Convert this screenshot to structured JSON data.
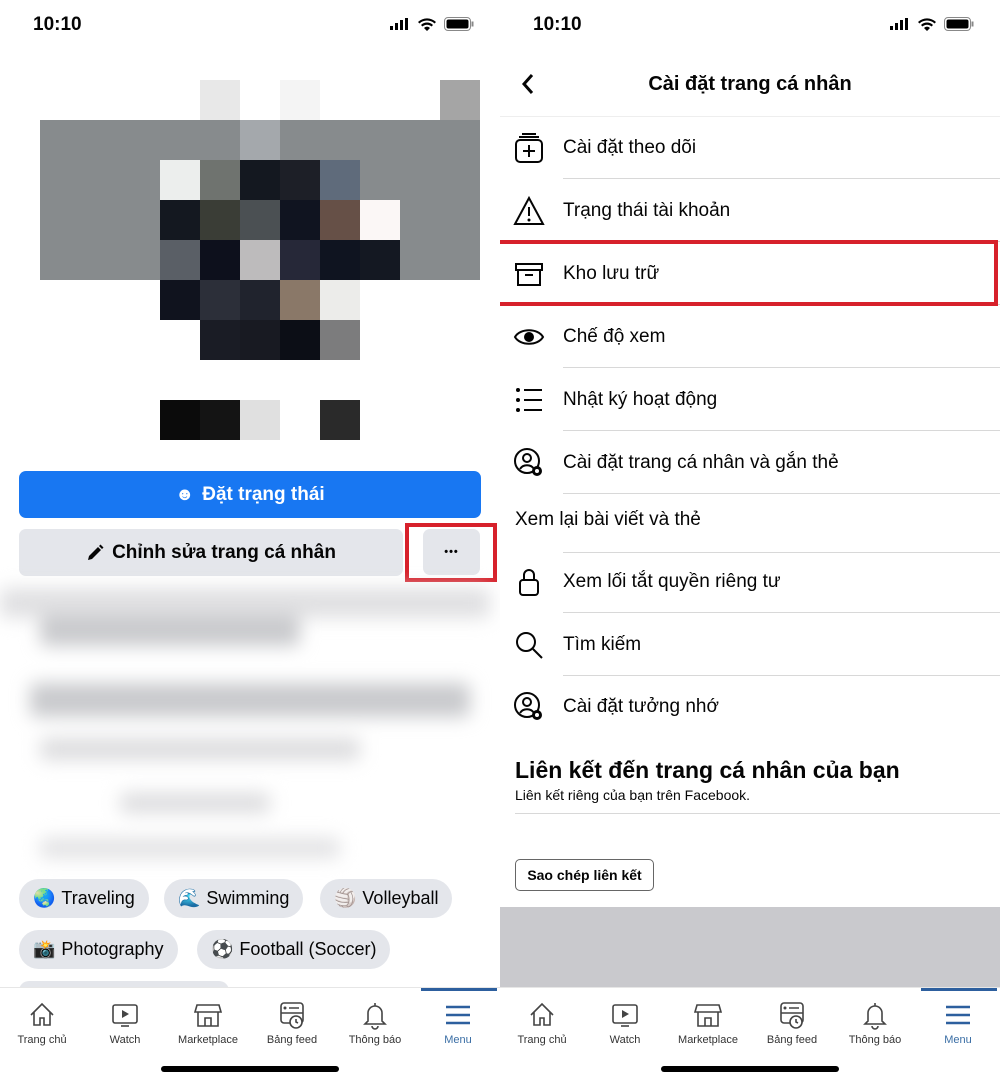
{
  "status": {
    "time": "10:10"
  },
  "left": {
    "set_status_label": "Đặt trạng thái",
    "edit_profile_label": "Chỉnh sửa trang cá nhân",
    "more_label": "•••",
    "hobbies": [
      {
        "emoji": "🌏",
        "label": "Traveling"
      },
      {
        "emoji": "🌊",
        "label": "Swimming"
      },
      {
        "emoji": "🏐",
        "label": "Volleyball"
      },
      {
        "emoji": "📸",
        "label": "Photography"
      },
      {
        "emoji": "⚽",
        "label": "Football (Soccer)"
      }
    ]
  },
  "right": {
    "title": "Cài đặt trang cá nhân",
    "items": [
      {
        "icon": "follow-settings-icon",
        "label": "Cài đặt theo dõi"
      },
      {
        "icon": "warning-icon",
        "label": "Trạng thái tài khoản"
      },
      {
        "icon": "archive-icon",
        "label": "Kho lưu trữ"
      },
      {
        "icon": "eye-icon",
        "label": "Chế độ xem"
      },
      {
        "icon": "list-icon",
        "label": "Nhật ký hoạt động"
      },
      {
        "icon": "profile-settings-icon",
        "label": "Cài đặt trang cá nhân và gắn thẻ"
      },
      {
        "icon": "",
        "label": "Xem lại bài viết và thẻ"
      },
      {
        "icon": "lock-icon",
        "label": "Xem lối tắt quyền riêng tư"
      },
      {
        "icon": "search-icon",
        "label": "Tìm kiếm"
      },
      {
        "icon": "memorial-settings-icon",
        "label": "Cài đặt tưởng nhớ"
      }
    ],
    "link_section": {
      "title": "Liên kết đến trang cá nhân của bạn",
      "subtitle": "Liên kết riêng của bạn trên Facebook.",
      "copy_label": "Sao chép liên kết"
    }
  },
  "nav": {
    "items": [
      {
        "icon": "home-icon",
        "label": "Trang chủ"
      },
      {
        "icon": "watch-icon",
        "label": "Watch"
      },
      {
        "icon": "marketplace-icon",
        "label": "Marketplace"
      },
      {
        "icon": "feed-icon",
        "label": "Bảng feed"
      },
      {
        "icon": "bell-icon",
        "label": "Thông báo"
      },
      {
        "icon": "menu-icon",
        "label": "Menu"
      }
    ],
    "active": "Menu"
  },
  "colors": {
    "primary": "#1877f2",
    "highlight": "#d7212b",
    "active_nav": "#2d5f9e"
  }
}
